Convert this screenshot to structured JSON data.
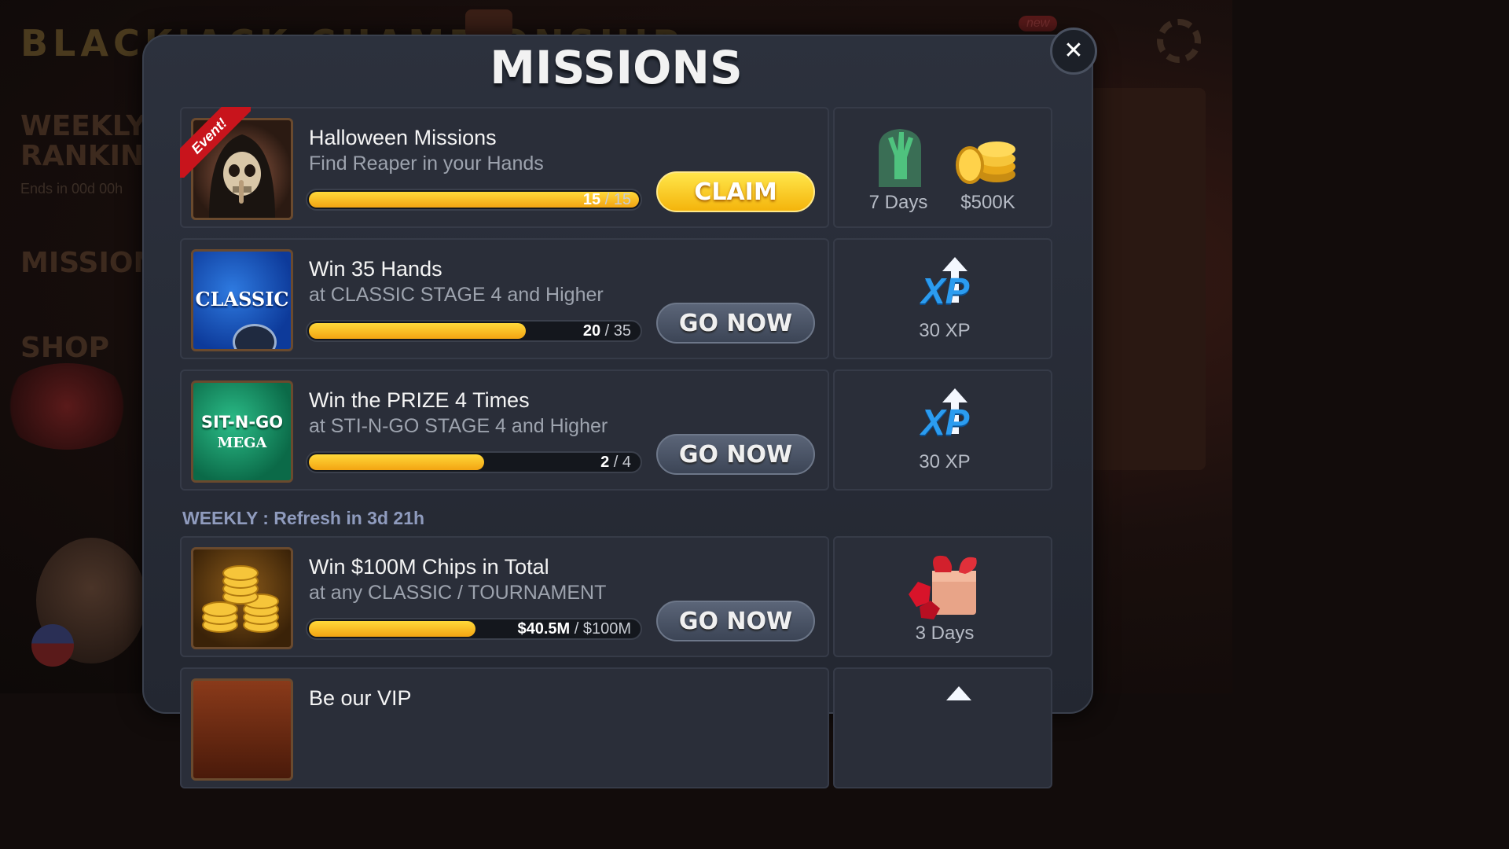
{
  "background": {
    "game_title": "BLACKJACK CHAMPIONSHIP",
    "side_items": [
      "WEEKLY RANKINGS",
      "MISSIONS",
      "SHOP"
    ],
    "ends_text": "Ends in 00d 00h",
    "new_badge": "new"
  },
  "modal": {
    "title": "MISSIONS",
    "close_label": "✕",
    "weekly_header": "WEEKLY : Refresh in 3d 21h"
  },
  "missions": [
    {
      "badge": "Event!",
      "thumb_label": "",
      "title": "Halloween Missions",
      "subtitle": "Find Reaper in your Hands",
      "progress_current": "15",
      "progress_total": "15",
      "progress_fraction": 1.0,
      "button": "CLAIM",
      "button_type": "claim",
      "rewards": [
        {
          "icon": "zombie-hand-icon",
          "label": "7 Days"
        },
        {
          "icon": "coins-icon",
          "label": "$500K"
        }
      ]
    },
    {
      "thumb_label": "CLASSIC",
      "title": "Win 35 Hands",
      "subtitle": "at CLASSIC STAGE 4 and Higher",
      "progress_current": "20",
      "progress_total": "35",
      "progress_fraction": 0.657,
      "button": "GO NOW",
      "button_type": "go",
      "rewards": [
        {
          "icon": "xp-icon",
          "label": "30 XP"
        }
      ]
    },
    {
      "thumb_label": "SIT-N-GO",
      "thumb_label2": "MEGA",
      "title": "Win the PRIZE 4 Times",
      "subtitle": "at STI-N-GO STAGE 4 and Higher",
      "progress_current": "2",
      "progress_total": "4",
      "progress_fraction": 0.53,
      "button": "GO NOW",
      "button_type": "go",
      "rewards": [
        {
          "icon": "xp-icon",
          "label": "30 XP"
        }
      ]
    },
    {
      "thumb_label": "",
      "title": "Win $100M Chips in Total",
      "subtitle": "at any CLASSIC / TOURNAMENT",
      "progress_current": "$40.5M",
      "progress_total": "$100M",
      "progress_fraction": 0.505,
      "button": "GO NOW",
      "button_type": "go",
      "rewards": [
        {
          "icon": "gift-box-icon",
          "label": "3 Days"
        }
      ]
    },
    {
      "title": "Be our VIP"
    }
  ],
  "colors": {
    "progress_fill": "#f8c21d",
    "claim_button": "#f7c416",
    "go_button": "#4c5568",
    "event_ribbon": "#c8141c",
    "xp_blue": "#2b9cf0",
    "weekly_header": "#8f9bbd"
  }
}
